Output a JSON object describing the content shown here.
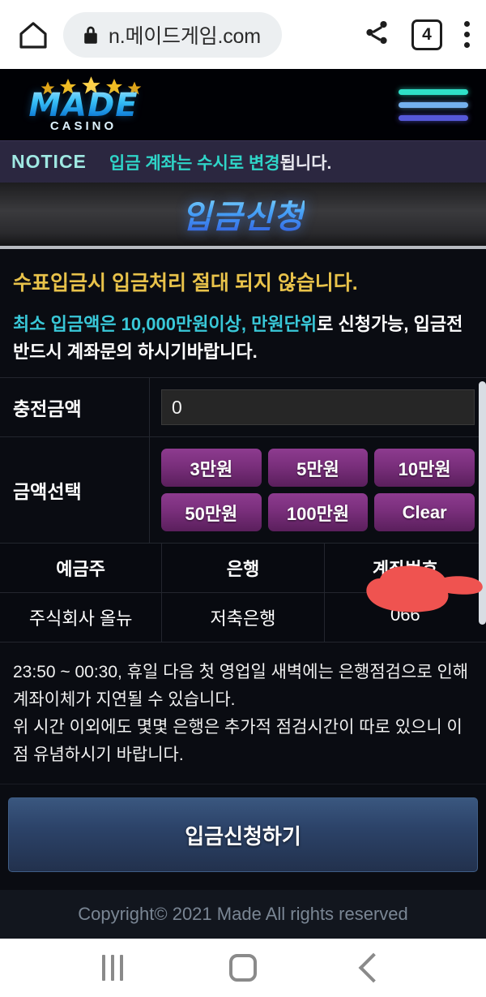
{
  "browser": {
    "url": "n.메이드게임.com",
    "home_icon": "home-icon",
    "lock_icon": "lock-icon",
    "share_icon": "share-icon",
    "tab_count": "4",
    "menu_icon": "kebab-menu-icon"
  },
  "site": {
    "logo_main": "MADE",
    "logo_sub": "CASINO",
    "stars_count": 5,
    "menu_icon": "hamburger-icon"
  },
  "notice_bar": {
    "label": "NOTICE",
    "message_highlight": "입금 계좌는 수시로 변경",
    "message_tail": "됩니다."
  },
  "page": {
    "title": "입금신청"
  },
  "warning": {
    "line1": "수표입금시 입금처리 절대 되지 않습니다.",
    "line2_cyan": "최소 입금액은 10,000만원이상, 만원단위",
    "line2_white": "로 신청가능, 입금전 반드시 계좌문의 하시기바랍니다."
  },
  "form": {
    "amount_label": "충전금액",
    "amount_value": "0",
    "amount_placeholder": "0",
    "select_label": "금액선택",
    "quick_buttons": [
      "3만원",
      "5만원",
      "10만원",
      "50만원",
      "100만원",
      "Clear"
    ]
  },
  "bank_table": {
    "headers": [
      "예금주",
      "은행",
      "계좌번호"
    ],
    "row": [
      "주식회사 올뉴",
      "저축은행",
      "066"
    ]
  },
  "bank_notice": {
    "line1": "23:50 ~ 00:30, 휴일 다음 첫 영업일 새벽에는 은행점검으로 인해 계좌이체가 지연될 수 있습니다.",
    "line2": "위 시간 이외에도 몇몇 은행은 추가적 점검시간이 따로 있으니 이점 유념하시기 바랍니다."
  },
  "submit": {
    "label": "입금신청하기"
  },
  "footer": {
    "copyright": "Copyright© 2021 Made All rights reserved"
  },
  "android_nav": {
    "recent_icon": "recent-apps-icon",
    "home_icon": "home-button-icon",
    "back_icon": "back-button-icon"
  },
  "annotation": {
    "shape": "red-pointing-hand"
  },
  "colors": {
    "accent_cyan": "#2fd5c8",
    "accent_gold": "#e8c24a",
    "button_purple": "#7a2f7c",
    "submit_blue": "#2c4369",
    "annotation_red": "#ef5350"
  }
}
